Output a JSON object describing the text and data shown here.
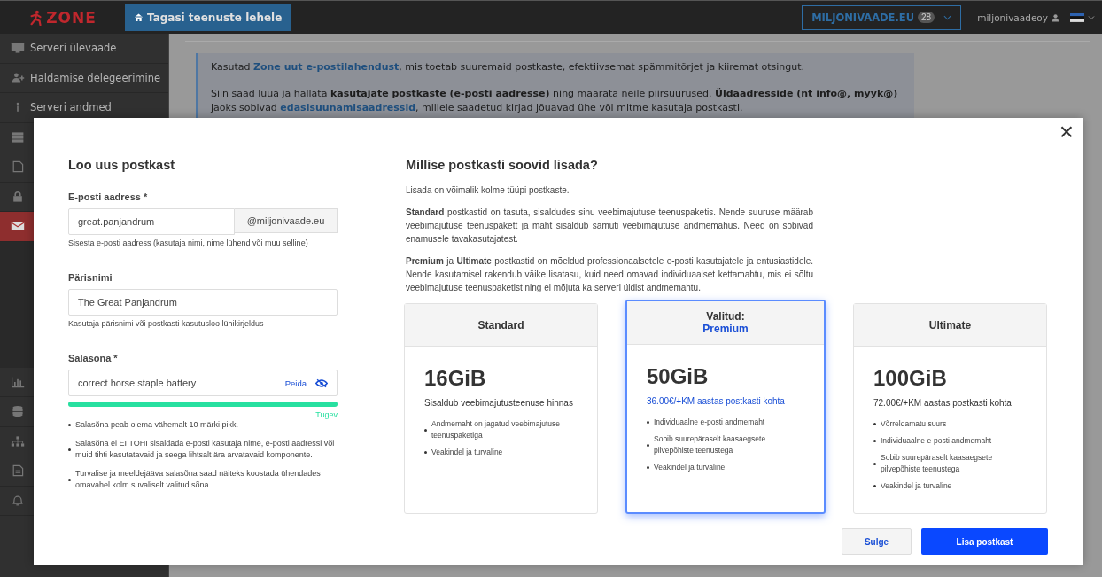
{
  "topbar": {
    "logo": "ZONE",
    "back_button": "Tagasi teenuste lehele",
    "domain": {
      "label": "MILJONIVAADE.EU",
      "count": "28"
    },
    "user": "miljonivaadeoy"
  },
  "sidebar": {
    "items": [
      {
        "label": "Serveri ülevaade",
        "kind": "item",
        "selected": false
      },
      {
        "label": "Haldamise delegeerimine",
        "kind": "item",
        "selected": false
      },
      {
        "label": "Serveri andmed",
        "kind": "item",
        "selected": false
      },
      {
        "kind": "item",
        "selected": false
      },
      {
        "kind": "item",
        "selected": false
      },
      {
        "kind": "item",
        "selected": false
      },
      {
        "kind": "item",
        "selected": true
      },
      {
        "kind": "item",
        "selected": false
      },
      {
        "kind": "item",
        "selected": false
      },
      {
        "kind": "item",
        "selected": false
      },
      {
        "kind": "item",
        "selected": false
      },
      {
        "kind": "item",
        "selected": false
      }
    ]
  },
  "info": {
    "paragraphs": [
      [
        {
          "kind": "text",
          "text": "Kasutad "
        },
        {
          "kind": "link",
          "text": "Zone uut e-postilahendust"
        },
        {
          "kind": "text",
          "text": ", mis toetab suuremaid postkaste, efektiivsemat spämmitõrjet ja kiiremat otsingut."
        }
      ],
      [
        {
          "kind": "text",
          "text": "Siin saad luua ja hallata "
        },
        {
          "kind": "bold",
          "text": "kasutajate postkaste (e-posti aadresse)"
        },
        {
          "kind": "text",
          "text": " ning määrata neile piirsuurused. "
        },
        {
          "kind": "bold",
          "text": "Üldaadresside (nt info@, myyk@)"
        },
        {
          "kind": "text",
          "text": " jaoks sobivad "
        },
        {
          "kind": "link",
          "text": "edasisuunamisaadressid"
        },
        {
          "kind": "text",
          "text": ", millele saadetud kirjad jõuavad ühe või mitme kasutaja postkasti."
        }
      ]
    ]
  },
  "modal": {
    "close": "×",
    "form": {
      "title": "Loo uus postkast",
      "email": {
        "label": "E-posti aadress *",
        "value": "great.panjandrum",
        "suffix": "@miljonivaade.eu",
        "help": "Sisesta e-posti aadress (kasutaja nimi, nime lühend või muu selline)"
      },
      "real_name": {
        "label": "Pärisnimi",
        "value": "The Great Panjandrum",
        "help": "Kasutaja pärisnimi või postkasti kasutusloo lühikirjeldus"
      },
      "password": {
        "label": "Salasõna *",
        "value": "correct horse staple battery",
        "toggle": "Peida",
        "strength": {
          "level": 1,
          "label": "Tugev"
        }
      },
      "rules": [
        "Salasõna peab olema vähemalt 10 märki pikk.",
        "Salasõna ei EI TOHI sisaldada e-posti kasutaja nime, e-posti aadressi või muid tihti kasutatavaid ja seega lihtsalt ära arvatavaid komponente.",
        "Turvalise ja meeldejääva salasõna saad näiteks koostada ühendades omavahel kolm suvaliselt valitud sõna."
      ]
    },
    "info": {
      "title": "Millise postkasti soovid lisada?",
      "paragraphs": [
        "Lisada on võimalik kolme tüüpi postkaste.",
        "**Standard** postkastid on tasuta, sisaldudes sinu veebimajutuse teenuspaketis. Nende suuruse määrab veebimajutuse teenuspakett ja maht sisaldub samuti veebimajutuse andmemahus. Need on sobivad enamusele tavakasutajatest.",
        "**Premium** ja **Ultimate** postkastid on mõeldud professionaalsetele e-posti kasutajatele ja entusiastidele. Nende kasutamisel rakendub väike lisatasu, kuid need omavad individuaalset kettamahtu, mis ei sõltu veebimajutuse teenuspaketist ning ei mõjuta ka serveri üldist andmemahtu."
      ]
    },
    "plans": [
      {
        "name": "Standard",
        "selected": false,
        "size": "16GiB",
        "price": "Sisaldub veebimajutusteenuse hinnas",
        "features": [
          "Andmemaht on jagatud veebimajutuse teenuspaketiga",
          "Veakindel ja turvaline"
        ]
      },
      {
        "note": "Valitud:",
        "name": "Premium",
        "selected": true,
        "size": "50GiB",
        "price": "36.00€/+KM aastas postkasti kohta",
        "features": [
          "Individuaalne e-posti andmemaht",
          "Sobib suurepäraselt kaasaegsete pilvepõhiste teenustega",
          "Veakindel ja turvaline"
        ]
      },
      {
        "name": "Ultimate",
        "selected": false,
        "size": "100GiB",
        "price": "72.00€/+KM aastas postkasti kohta",
        "features": [
          "Võrreldamatu suurs",
          "Individuaalne e-posti andmemaht",
          "Sobib suurepäraselt kaasaegsete pilvepõhiste teenustega",
          "Veakindel ja turvaline"
        ]
      }
    ],
    "buttons": {
      "cancel": "Sulge",
      "submit": "Lisa postkast"
    }
  }
}
